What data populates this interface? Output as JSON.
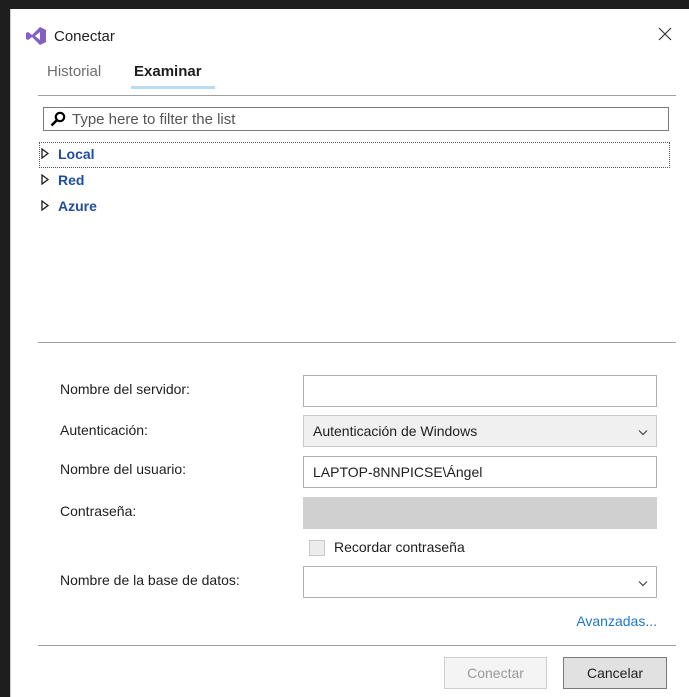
{
  "window": {
    "title": "Conectar",
    "icon": "visual-studio-logo",
    "close_icon": "close-icon"
  },
  "tabs": [
    {
      "label": "Historial",
      "active": false
    },
    {
      "label": "Examinar",
      "active": true
    }
  ],
  "filter": {
    "placeholder": "Type here to filter the list",
    "icon": "search-icon"
  },
  "tree": [
    {
      "label": "Local",
      "expanded": false,
      "focused": true
    },
    {
      "label": "Red",
      "expanded": false,
      "focused": false
    },
    {
      "label": "Azure",
      "expanded": false,
      "focused": false
    }
  ],
  "form": {
    "server_name": {
      "label": "Nombre del servidor:",
      "value": ""
    },
    "auth": {
      "label": "Autenticación:",
      "value": "Autenticación de Windows"
    },
    "user": {
      "label": "Nombre del usuario:",
      "value": "LAPTOP-8NNPICSE\\Ángel"
    },
    "password": {
      "label": "Contraseña:",
      "value": ""
    },
    "remember": {
      "label": "Recordar contraseña",
      "checked": false
    },
    "database": {
      "label": "Nombre de la base de datos:",
      "value": ""
    }
  },
  "advanced_link": "Avanzadas...",
  "buttons": {
    "connect": "Conectar",
    "cancel": "Cancelar"
  },
  "colors": {
    "accent_link": "#1f77c8",
    "tree_text": "#1f4e9e",
    "logo": "#865fc5"
  }
}
